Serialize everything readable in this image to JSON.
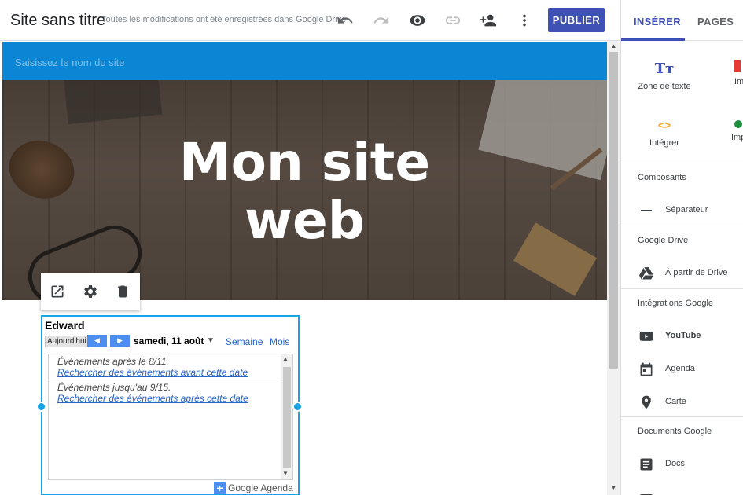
{
  "topbar": {
    "site_title": "Site sans titre",
    "save_status": "Toutes les modifications ont été enregistrées dans Google Drive",
    "icons": [
      "undo-icon",
      "redo-icon",
      "preview-icon",
      "link-icon",
      "share-icon",
      "more-vert-icon"
    ],
    "publish_label": "PUBLIER",
    "accent": "#3f51b5"
  },
  "side_panel": {
    "tabs": [
      "INSÉRER",
      "PAGES"
    ],
    "tiles": {
      "text_box": "Zone de texte",
      "embed": "Intégrer",
      "partial_1": "Im",
      "partial_2": "Imp"
    },
    "sections": {
      "components": {
        "title": "Composants",
        "items": [
          "Séparateur"
        ]
      },
      "drive": {
        "title": "Google Drive",
        "items": [
          "À partir de Drive"
        ]
      },
      "integrations": {
        "title": "Intégrations Google",
        "items": [
          "YouTube",
          "Agenda",
          "Carte"
        ]
      },
      "documents": {
        "title": "Documents Google",
        "items": [
          "Docs"
        ]
      }
    }
  },
  "canvas": {
    "name_placeholder": "Saisissez le nom du site",
    "band_color": "#0a86d4",
    "hero_title_line1": "Mon site",
    "hero_title_line2": "web"
  },
  "calendar": {
    "owner": "Edward",
    "today": "Aujourd'hui",
    "prev": "◀",
    "next": "▶",
    "date": "samedi, 11 août",
    "views": [
      "Semaine",
      "Mois"
    ],
    "events": [
      {
        "text": "Événements après le 8/11.",
        "link": "Rechercher des événements avant cette date"
      },
      {
        "text": "Événements jusqu'au 9/15.",
        "link": "Rechercher des événements après cette date"
      }
    ],
    "footer": "Google Agenda",
    "selection_color": "#1aa1e6"
  }
}
